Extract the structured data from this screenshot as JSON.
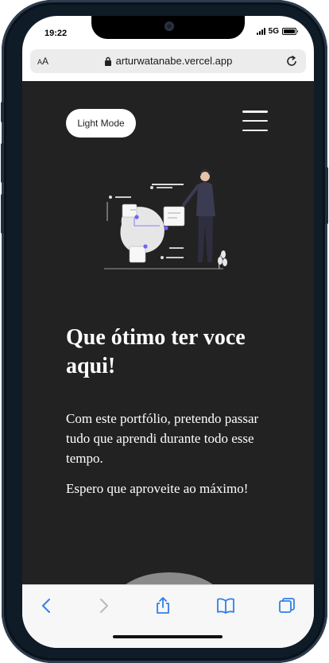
{
  "status": {
    "time": "19:22",
    "network": "5G"
  },
  "browser": {
    "text_size_label": "AA",
    "url": "arturwatanabe.vercel.app"
  },
  "page": {
    "mode_button": "Light Mode",
    "headline": "Que ótimo ter voce aqui!",
    "paragraphs": [
      "Com este portfólio, pretendo passar tudo que aprendi durante todo esse tempo.",
      "Espero que aproveite ao máximo!"
    ]
  },
  "colors": {
    "page_bg": "#222222",
    "accent": "#6c63ff",
    "browser_icons": "#2f80ed"
  },
  "icons": {
    "toolbar": [
      "back-icon",
      "forward-icon",
      "share-icon",
      "bookmarks-icon",
      "tabs-icon"
    ],
    "urlbar": [
      "lock-icon",
      "reload-icon"
    ]
  }
}
